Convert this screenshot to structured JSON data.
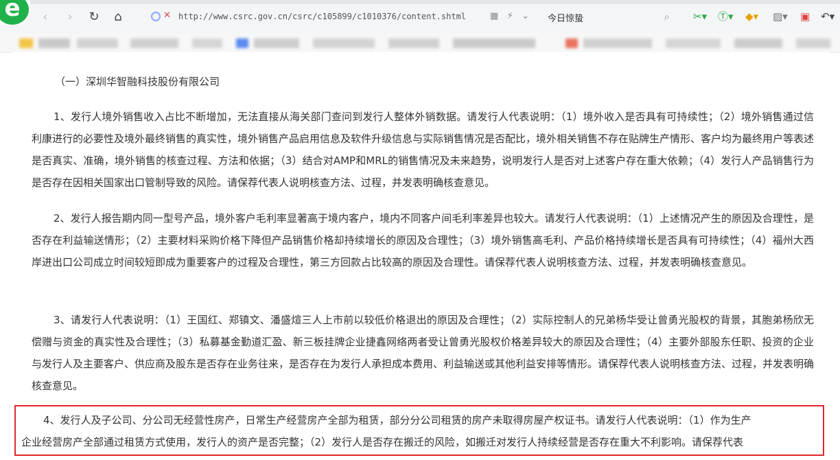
{
  "browser": {
    "url": "http://www.csrc.gov.cn/csrc/c105899/c1010376/content.shtml",
    "search_query": "今日惊蛰",
    "logo_letter": "e"
  },
  "article": {
    "section_title": "（一）深圳华智融科技股份有限公司",
    "paragraphs": [
      "1、发行人境外销售收入占比不断增加，无法直接从海关部门查问到发行人整体外销数据。请发行人代表说明：（1）境外收入是否具有可持续性；（2）境外销售通过信利康进行的必要性及境外最终销售的真实性，境外销售产品启用信息及软件升级信息与实际销售情况是否配比，境外相关销售不存在贴牌生产情形、客户均为最终用户等表述是否真实、准确，境外销售的核查过程、方法和依据；（3）结合对AMP和MRL的销售情况及未来趋势，说明发行人是否对上述客户存在重大依赖；（4）发行人产品销售行为是否存在因相关国家出口管制导致的风险。请保荐代表人说明核查方法、过程，并发表明确核查意见。",
      "2、发行人报告期内同一型号产品，境外客户毛利率显著高于境内客户，境内不同客户间毛利率差异也较大。请发行人代表说明：（1）上述情况产生的原因及合理性，是否存在利益输送情形；（2）主要材料采购价格下降但产品销售价格却持续增长的原因及合理性；（3）境外销售高毛利、产品价格持续增长是否具有可持续性；（4）福州大西岸进出口公司成立时间较短即成为重要客户的过程及合理性，第三方回款占比较高的原因及合理性。请保荐代表人说明核查方法、过程，并发表明确核查意见。",
      "3、请发行人代表说明：（1）王国红、郑镇文、潘盛煊三人上市前以较低价格退出的原因及合理性；（2）实际控制人的兄弟杨华受让曾勇光股权的背景，其胞弟杨欣无偿赠与资金的真实性及合理性；（3）私募基金勤道汇盈、新三板挂牌企业捷鑫网络两者受让曾勇光股权价格差异较大的原因及合理性；（4）主要外部股东任职、投资的企业与发行人及主要客户、供应商及股东是否存在业务往来，是否存在为发行人承担成本费用、利益输送或其他利益安排等情形。请保荐代表人说明核查方法、过程，并发表明确核查意见。"
    ],
    "highlight_lines": [
      "4、发行人及子公司、分公司无经营性房产，日常生产经营房产全部为租赁，部分分公司租赁的房产未取得房屋产权证书。请发行人代表说明：（1）作为生产",
      "企业经营房产全部通过租赁方式使用，发行人的资产是否完整；（2）发行人是否存在搬迁的风险，如搬迁对发行人持续经营是否存在重大不利影响。请保荐代表"
    ]
  }
}
